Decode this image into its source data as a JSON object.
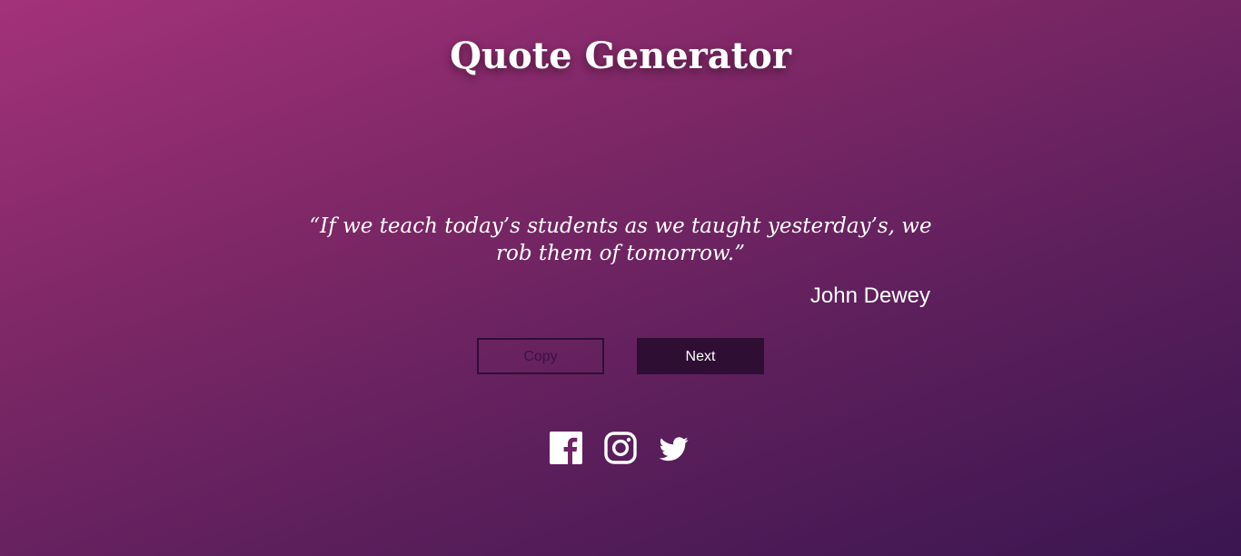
{
  "app": {
    "title": "Quote Generator"
  },
  "quote": {
    "text": "“If we teach today’s students as we taught yesterday’s, we rob them of tomorrow.”",
    "author": "John Dewey"
  },
  "buttons": {
    "copy_label": "Copy",
    "next_label": "Next"
  },
  "social": {
    "icons": [
      "facebook-icon",
      "instagram-icon",
      "twitter-icon"
    ]
  },
  "colors": {
    "gradient_start": "#a3327a",
    "gradient_end": "#3a1650",
    "button_dark": "#2e0f33",
    "text": "#ffffff"
  }
}
